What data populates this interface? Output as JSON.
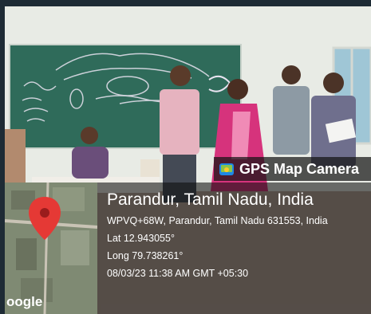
{
  "overlay": {
    "app_title": "GPS Map Camera",
    "place": "Parandur, Tamil Nadu, India",
    "address": "WPVQ+68W, Parandur, Tamil Nadu 631553, India",
    "latitude": "Lat 12.943055°",
    "longitude": "Long 79.738261°",
    "datetime": "08/03/23 11:38 AM GMT +05:30",
    "map_brand": "oogle"
  },
  "colors": {
    "board": "#2f6b5a",
    "wall": "#e9ece6",
    "pin": "#e53935"
  },
  "icons": {
    "camera": "camera-icon",
    "pin": "map-pin-icon"
  }
}
